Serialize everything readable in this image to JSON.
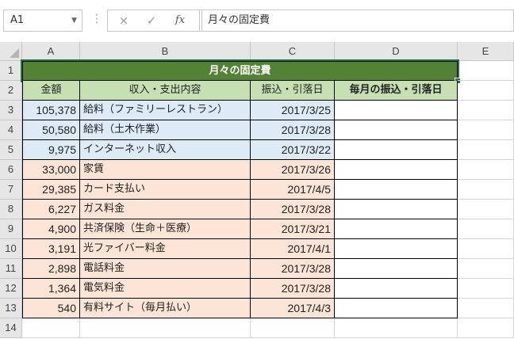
{
  "name_box": "A1",
  "formula_bar_value": "月々の固定費",
  "icons": {
    "cancel": "×",
    "confirm": "✓",
    "function": "fx"
  },
  "columns": [
    "A",
    "B",
    "C",
    "D",
    "E"
  ],
  "rows": [
    "1",
    "2",
    "3",
    "4",
    "5",
    "6",
    "7",
    "8",
    "9",
    "10",
    "11",
    "12",
    "13",
    "14"
  ],
  "title": "月々の固定費",
  "headers": [
    "金額",
    "収入・支出内容",
    "振込・引落日",
    "毎月の振込・引落日"
  ],
  "income": [
    {
      "amount": "105,378",
      "item": "給料（ファミリーレストラン）",
      "date": "2017/3/25"
    },
    {
      "amount": "50,580",
      "item": "給料（土木作業）",
      "date": "2017/3/28"
    },
    {
      "amount": "9,975",
      "item": "インターネット収入",
      "date": "2017/3/22"
    }
  ],
  "expenses": [
    {
      "amount": "33,000",
      "item": "家賃",
      "date": "2017/3/26"
    },
    {
      "amount": "29,385",
      "item": "カード支払い",
      "date": "2017/4/5"
    },
    {
      "amount": "6,227",
      "item": "ガス料金",
      "date": "2017/3/28"
    },
    {
      "amount": "4,900",
      "item": "共済保険（生命＋医療）",
      "date": "2017/3/21"
    },
    {
      "amount": "3,191",
      "item": "光ファイバー料金",
      "date": "2017/4/1"
    },
    {
      "amount": "2,898",
      "item": "電話料金",
      "date": "2017/3/28"
    },
    {
      "amount": "1,364",
      "item": "電気料金",
      "date": "2017/3/28"
    },
    {
      "amount": "540",
      "item": "有料サイト（毎月払い）",
      "date": "2017/4/3"
    }
  ],
  "colors": {
    "title_bg": "#548235",
    "header_bg": "#c6e0b4",
    "income_bg": "#ddebf7",
    "expense_bg": "#fce4d6",
    "selection": "#217346"
  }
}
